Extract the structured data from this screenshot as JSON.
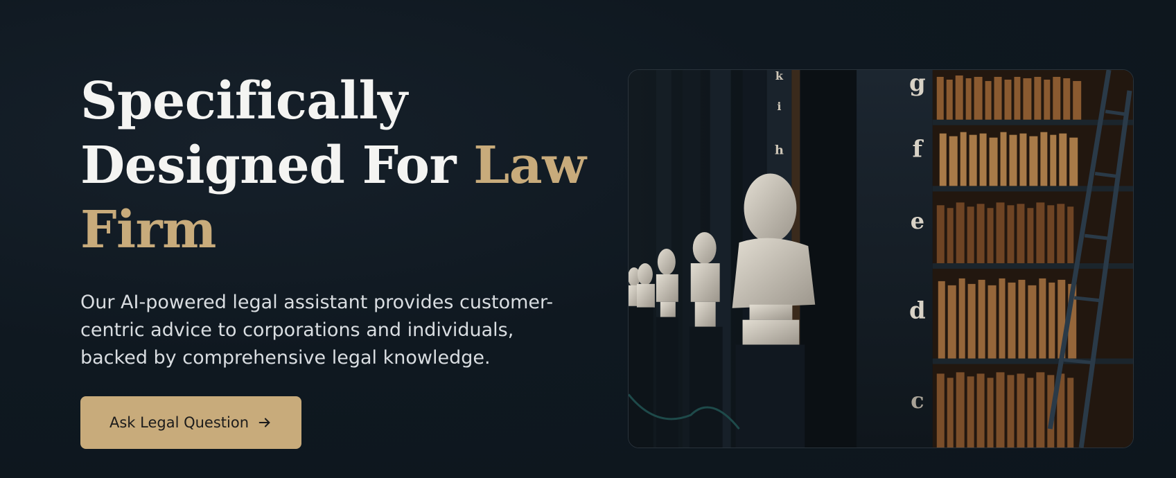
{
  "hero": {
    "headline_line1": "Specifically",
    "headline_line2_plain": "Designed For ",
    "headline_line2_accent": "Law",
    "headline_line3_accent": "Firm",
    "description": "Our AI-powered legal assistant provides customer-centric advice to corporations and individuals, backed by comprehensive legal knowledge.",
    "cta_label": "Ask Legal Question",
    "cta_icon": "arrow-right-icon"
  },
  "image": {
    "description_icon": "library-photo",
    "shelf_letters": [
      "k",
      "i",
      "h",
      "g",
      "g",
      "f",
      "e",
      "d",
      "c"
    ]
  },
  "colors": {
    "background": "#0f1820",
    "accent": "#c8ab7b",
    "headline": "#f4f4f2",
    "body_text": "#d9dde1",
    "button_text": "#1b1b1b"
  }
}
